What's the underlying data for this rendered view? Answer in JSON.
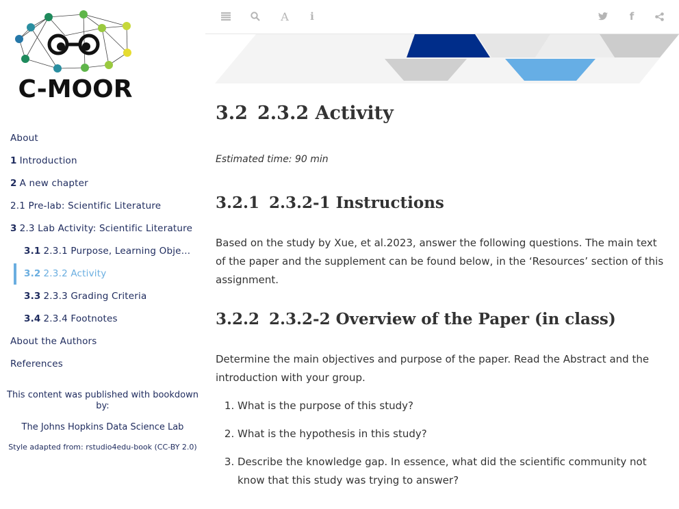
{
  "sidebar": {
    "logo_text": "C-MOOR",
    "toc": [
      {
        "num": "",
        "label": "About",
        "level": 1,
        "active": false
      },
      {
        "num": "1",
        "label": "Introduction",
        "level": 1,
        "active": false
      },
      {
        "num": "2",
        "label": "A new chapter",
        "level": 1,
        "active": false
      },
      {
        "num": "",
        "label": "2.1 Pre-lab: Scientific Literature",
        "level": 1,
        "active": false
      },
      {
        "num": "3",
        "label": "2.3 Lab Activity: Scientific Literature",
        "level": 1,
        "active": false
      },
      {
        "num": "3.1",
        "label": "2.3.1 Purpose, Learning Objectives …",
        "level": 2,
        "active": false
      },
      {
        "num": "3.2",
        "label": "2.3.2 Activity",
        "level": 2,
        "active": true
      },
      {
        "num": "3.3",
        "label": "2.3.3 Grading Criteria",
        "level": 2,
        "active": false
      },
      {
        "num": "3.4",
        "label": "2.3.4 Footnotes",
        "level": 2,
        "active": false
      },
      {
        "num": "",
        "label": "About the Authors",
        "level": 1,
        "active": false
      },
      {
        "num": "",
        "label": "References",
        "level": 1,
        "active": false
      }
    ],
    "published_line": "This content was published with bookdown by:",
    "lab_name": "The Johns Hopkins Data Science Lab",
    "style_line": "Style adapted from: rstudio4edu-book (CC-BY 2.0)"
  },
  "toolbar": {
    "left_icons": [
      "toc-toggle-icon",
      "search-icon",
      "font-settings-icon",
      "info-icon"
    ],
    "right_icons": [
      "twitter-icon",
      "facebook-icon",
      "share-icon"
    ]
  },
  "content": {
    "chapter_num": "3.2",
    "chapter_title": "2.3.2 Activity",
    "estimated_time": "Estimated time: 90 min",
    "sec1_num": "3.2.1",
    "sec1_title": "2.3.2-1 Instructions",
    "sec1_body": "Based on the study by Xue, et al.2023, answer the following questions. The main text of the paper and the supplement can be found below, in the ‘Resources’ section of this assignment.",
    "sec2_num": "3.2.2",
    "sec2_title": "2.3.2-2 Overview of the Paper (in class)",
    "sec2_body": "Determine the main objectives and purpose of the paper. Read the Abstract and the introduction with your group.",
    "questions": [
      "What is the purpose of this study?",
      "What is the hypothesis in this study?",
      "Describe the knowledge gap. In essence, what did the scientific community not know that this study was trying to answer?"
    ]
  },
  "colors": {
    "nav_text": "#1d2a5d",
    "active": "#6aaee0",
    "banner_navy": "#002d8a",
    "banner_blue": "#66aee5"
  }
}
